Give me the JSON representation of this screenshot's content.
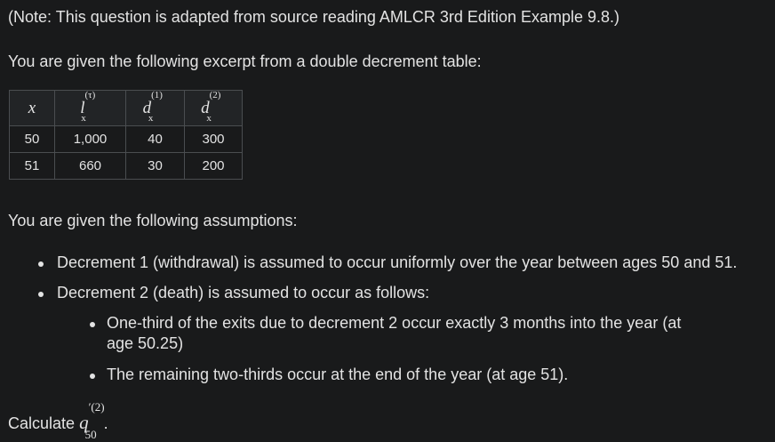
{
  "note": "(Note: This question is adapted from source reading AMLCR 3rd Edition Example 9.8.)",
  "intro": "You are given the following excerpt from a double decrement table:",
  "table": {
    "headers": [
      {
        "base": "x",
        "sup": "",
        "sub": ""
      },
      {
        "base": "l",
        "sup": "(τ)",
        "sub": "x"
      },
      {
        "base": "d",
        "sup": "(1)",
        "sub": "x"
      },
      {
        "base": "d",
        "sup": "(2)",
        "sub": "x"
      }
    ],
    "rows": [
      [
        "50",
        "1,000",
        "40",
        "300"
      ],
      [
        "51",
        "660",
        "30",
        "200"
      ]
    ]
  },
  "assumptions_intro": "You are given the following assumptions:",
  "bullets": [
    "Decrement 1 (withdrawal) is assumed to occur uniformly over the year between ages 50 and 51.",
    "Decrement 2 (death) is assumed to occur as follows:"
  ],
  "sub_bullets": [
    "One-third of the exits due to decrement 2 occur exactly 3 months into the year (at",
    "age 50.25)",
    "The remaining two-thirds occur at the end of the year (at age 51)."
  ],
  "question": {
    "prefix": "Calculate",
    "base": "q",
    "sup": "′(2)",
    "sub": "50",
    "suffix": "."
  }
}
